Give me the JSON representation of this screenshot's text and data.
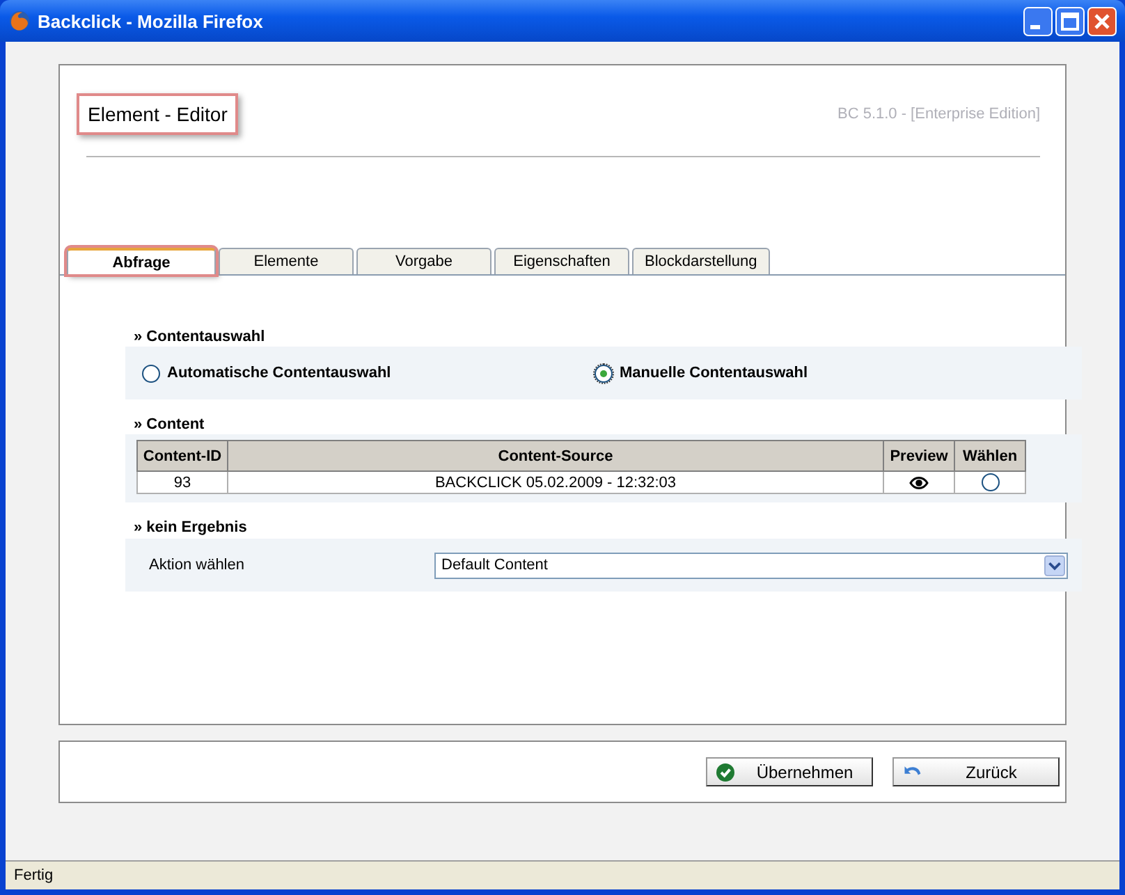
{
  "window": {
    "title": "Backclick - Mozilla Firefox"
  },
  "header": {
    "title": "Element - Editor",
    "highlighted": true,
    "version": "BC 5.1.0 - [Enterprise Edition]"
  },
  "tabs": [
    {
      "label": "Abfrage",
      "selected": true,
      "highlighted": true
    },
    {
      "label": "Elemente",
      "selected": false,
      "highlighted": false
    },
    {
      "label": "Vorgabe",
      "selected": false,
      "highlighted": false
    },
    {
      "label": "Eigenschaften",
      "selected": false,
      "highlighted": false
    },
    {
      "label": "Blockdarstellung",
      "selected": false,
      "highlighted": false
    }
  ],
  "content_selection": {
    "heading": "» Contentauswahl",
    "options": [
      {
        "label": "Automatische Contentauswahl",
        "selected": false
      },
      {
        "label": "Manuelle Contentauswahl",
        "selected": true
      }
    ]
  },
  "content": {
    "heading": "» Content",
    "columns": [
      "Content-ID",
      "Content-Source",
      "Preview",
      "Wählen"
    ],
    "rows": [
      {
        "id": "93",
        "source": "BACKCLICK 05.02.2009 - 12:32:03",
        "selected": false
      }
    ]
  },
  "no_result": {
    "heading": "» kein Ergebnis",
    "label": "Aktion wählen",
    "value": "Default Content"
  },
  "buttons": [
    {
      "label": "Übernehmen",
      "kind": "apply"
    },
    {
      "label": "Zurück",
      "kind": "back"
    }
  ],
  "status_bar": "Fertig"
}
